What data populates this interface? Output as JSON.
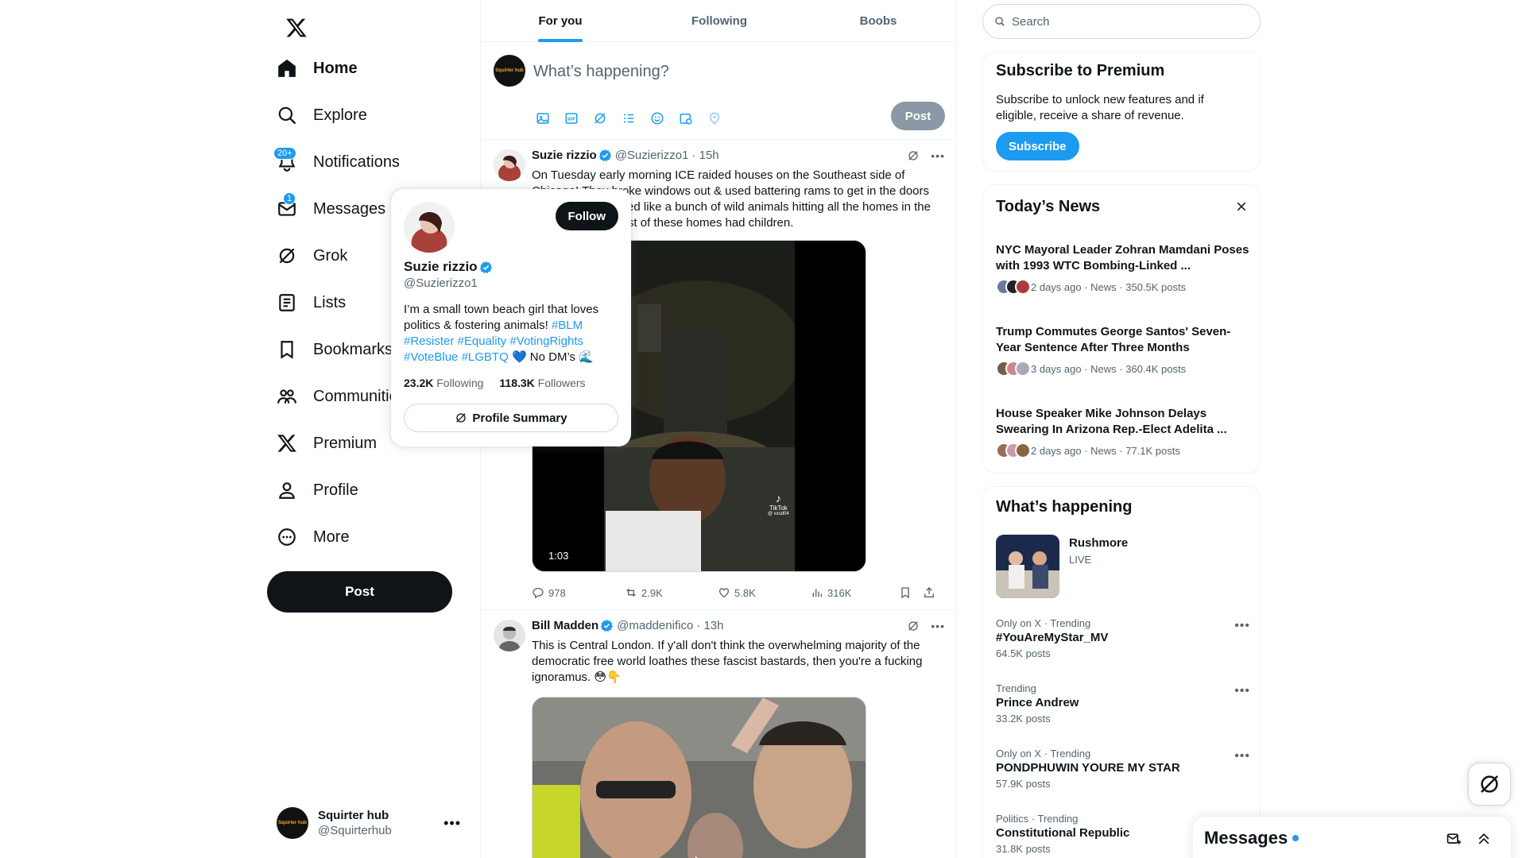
{
  "nav": {
    "items": [
      {
        "label": "Home",
        "icon": "home-icon"
      },
      {
        "label": "Explore",
        "icon": "search-icon"
      },
      {
        "label": "Notifications",
        "icon": "bell-icon",
        "badge": "20+"
      },
      {
        "label": "Messages",
        "icon": "mail-icon",
        "badge": "1"
      },
      {
        "label": "Grok",
        "icon": "grok-icon"
      },
      {
        "label": "Lists",
        "icon": "list-icon"
      },
      {
        "label": "Bookmarks",
        "icon": "bookmark-icon"
      },
      {
        "label": "Communities",
        "icon": "communities-icon"
      },
      {
        "label": "Premium",
        "icon": "x-logo-icon"
      },
      {
        "label": "Profile",
        "icon": "profile-icon"
      },
      {
        "label": "More",
        "icon": "more-circle-icon"
      }
    ],
    "post_label": "Post",
    "account": {
      "name": "Squirter hub",
      "handle": "@Squirterhub",
      "avatar_text": "Squirter hub"
    }
  },
  "tabs": [
    {
      "label": "For you",
      "active": true
    },
    {
      "label": "Following",
      "active": false
    },
    {
      "label": "Boobs",
      "active": false
    }
  ],
  "composer": {
    "placeholder": "What’s happening?",
    "post_label": "Post"
  },
  "tweets": [
    {
      "name": "Suzie rizzio",
      "handle": "@Suzierizzo1",
      "time": "· 15h",
      "text": "On Tuesday early morning ICE raided houses on the Southeast side of Chicago! They broke windows out & used battering rams to get in the doors and It literally looked like a bunch of wild animals hitting all the homes in the neighborhood! Most of these homes had children.",
      "video_duration": "1:03",
      "watermark": "TikTok",
      "watermark_user": "@ xxsd04",
      "replies": "978",
      "reposts": "2.9K",
      "likes": "5.8K",
      "views": "316K"
    },
    {
      "name": "Bill Madden",
      "handle": "@maddenifico",
      "time": "· 13h",
      "text": "This is Central London. If y'all don't think the overwhelming majority of the democratic free world loathes these fascist bastards, then you're a fucking ignoramus. 😳👇"
    }
  ],
  "hovercard": {
    "follow_label": "Follow",
    "name": "Suzie rizzio",
    "handle": "@Suzierizzo1",
    "bio_text": "I’m a small town beach girl that loves politics & fostering animals!",
    "bio_tags": [
      "#BLM",
      "#Resister",
      "#Equality",
      "#VotingRights",
      "#VoteBlue",
      "#LGBTQ"
    ],
    "bio_tail": "💙 No DM’s 🌊",
    "following_count": "23.2K",
    "following_label": "Following",
    "followers_count": "118.3K",
    "followers_label": "Followers",
    "summary_label": "Profile Summary"
  },
  "search": {
    "placeholder": "Search"
  },
  "premium": {
    "title": "Subscribe to Premium",
    "text": "Subscribe to unlock new features and if eligible, receive a share of revenue.",
    "button": "Subscribe"
  },
  "news": {
    "title": "Today’s News",
    "items": [
      {
        "title": "NYC Mayoral Leader Zohran Mamdani Poses with 1993 WTC Bombing-Linked ...",
        "meta": "2 days ago · News · 350.5K posts"
      },
      {
        "title": "Trump Commutes George Santos' Seven-Year Sentence After Three Months",
        "meta": "3 days ago · News · 360.4K posts"
      },
      {
        "title": "House Speaker Mike Johnson Delays Swearing In Arizona Rep.-Elect Adelita ...",
        "meta": "2 days ago · News · 77.1K posts"
      }
    ]
  },
  "happening": {
    "title": "What’s happening",
    "live": {
      "name": "Rushmore",
      "status": "LIVE"
    },
    "trends": [
      {
        "context": "Only on X · Trending",
        "name": "#YouAreMyStar_MV",
        "posts": "64.5K posts"
      },
      {
        "context": "Trending",
        "name": "Prince Andrew",
        "posts": "33.2K posts"
      },
      {
        "context": "Only on X · Trending",
        "name": "PONDPHUWIN YOURE MY STAR",
        "posts": "57.9K posts"
      },
      {
        "context": "Politics · Trending",
        "name": "Constitutional Republic",
        "posts": "31.8K posts"
      }
    ]
  },
  "messages_drawer": {
    "title": "Messages"
  },
  "colors": {
    "accent": "#1d9bf0",
    "text": "#0f1419",
    "muted": "#536471",
    "border": "#eff3f4"
  }
}
